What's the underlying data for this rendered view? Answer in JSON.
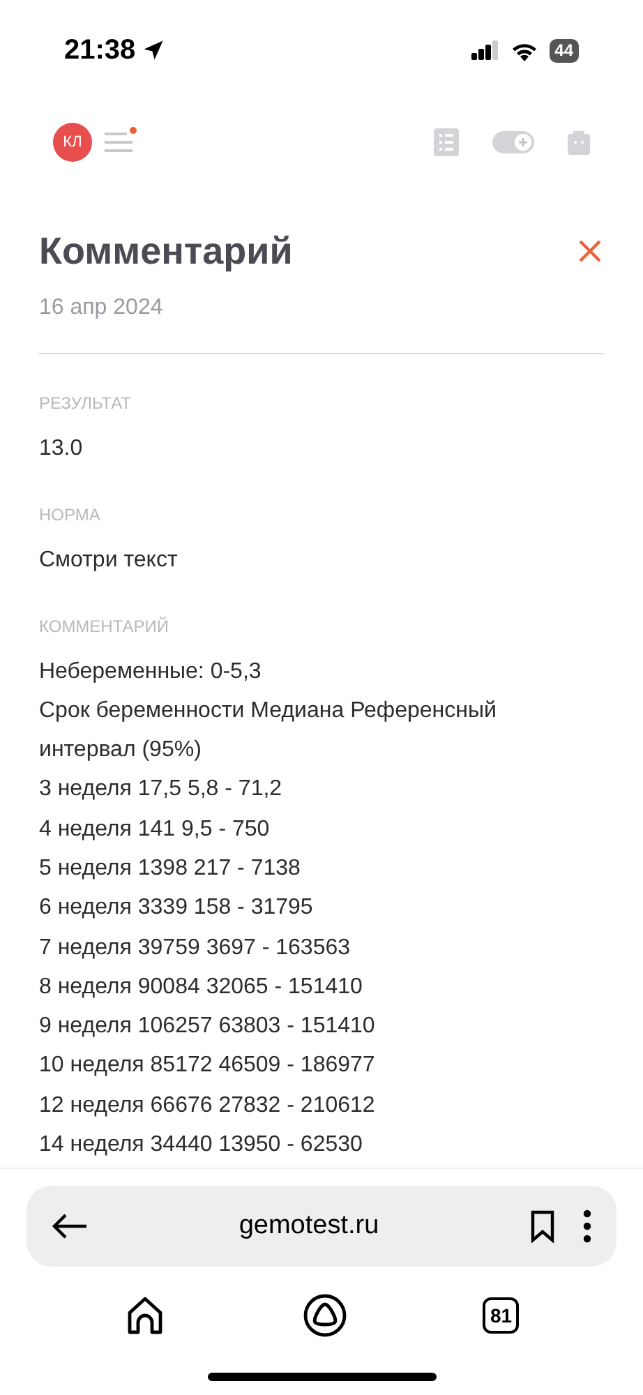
{
  "status_bar": {
    "time": "21:38",
    "battery": "44"
  },
  "header": {
    "avatar": "КЛ",
    "menu_notification": true
  },
  "title": "Комментарий",
  "date": "16 апр 2024",
  "fields": [
    {
      "label": "РЕЗУЛЬТАТ",
      "value": "13.0"
    },
    {
      "label": "НОРМА",
      "value": "Смотри текст"
    }
  ],
  "comment": {
    "label": "КОММЕНТАРИЙ",
    "lines": [
      "Небеременные: 0-5,3",
      "Срок беременности Медиана Референсный интервал (95%)",
      "3 неделя 17,5 5,8 - 71,2",
      "4 неделя 141 9,5 - 750",
      "5 неделя 1398 217 - 7138",
      "6 неделя 3339 158 - 31795",
      "7 неделя 39759 3697 - 163563",
      "8 неделя 90084 32065 - 151410",
      "9 неделя 106257 63803 - 151410",
      "10 неделя 85172 46509 - 186977",
      "12 неделя 66676 27832 - 210612",
      "14 неделя 34440 13950 - 62530"
    ]
  },
  "browser": {
    "url": "gemotest.ru",
    "tabs_count": "81"
  }
}
